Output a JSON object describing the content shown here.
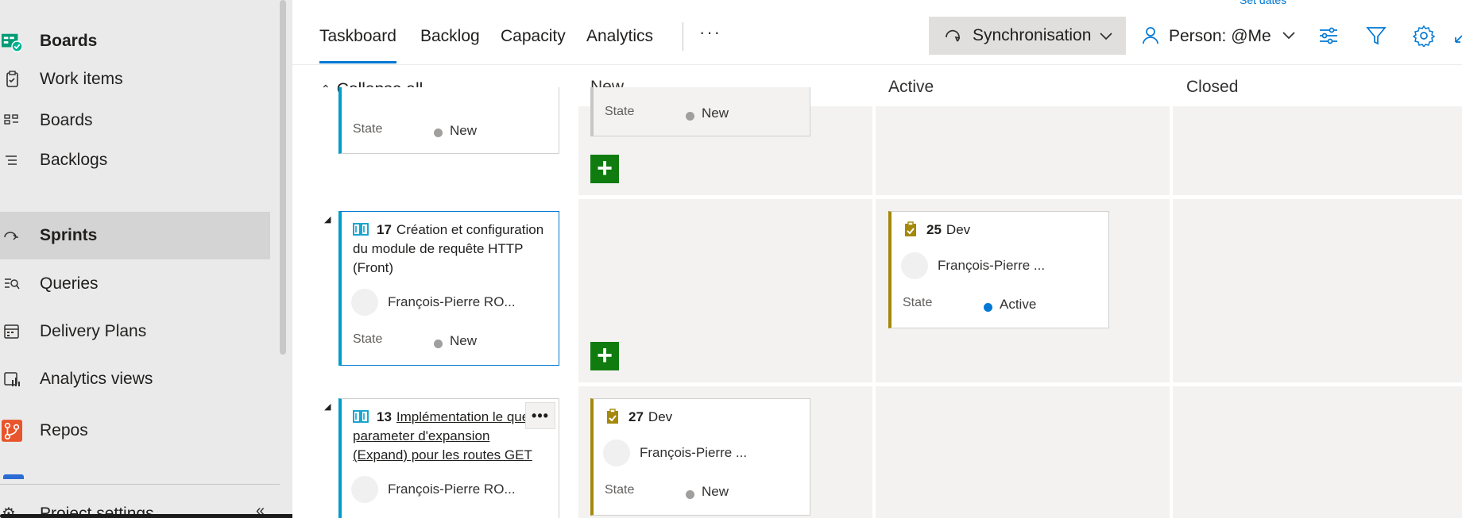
{
  "sidebar": {
    "items": [
      {
        "label": "Boards",
        "icon": "boards-hub-icon"
      },
      {
        "label": "Work items",
        "icon": "work-items-icon"
      },
      {
        "label": "Boards",
        "icon": "boards-icon"
      },
      {
        "label": "Backlogs",
        "icon": "backlogs-icon"
      },
      {
        "label": "Sprints",
        "icon": "sprints-icon"
      },
      {
        "label": "Queries",
        "icon": "queries-icon"
      },
      {
        "label": "Delivery Plans",
        "icon": "delivery-plans-icon"
      },
      {
        "label": "Analytics views",
        "icon": "analytics-views-icon"
      },
      {
        "label": "Repos",
        "icon": "repos-icon"
      }
    ],
    "project_settings": "Project settings"
  },
  "tabs": {
    "items": [
      "Taskboard",
      "Backlog",
      "Capacity",
      "Analytics"
    ],
    "active": "Taskboard",
    "more": "···"
  },
  "toolbar": {
    "set_dates": "Set dates",
    "sync_label": "Synchronisation",
    "person_label": "Person: @Me"
  },
  "board": {
    "collapse_all": "Collapse all",
    "columns": [
      "New",
      "Active",
      "Closed"
    ],
    "state_label": "State",
    "rows": [
      {
        "story": {
          "state": "New"
        },
        "new_cards": [
          {
            "state": "New"
          }
        ]
      },
      {
        "story": {
          "id": "17",
          "title": "Création et configuration du module de requête HTTP (Front)",
          "assignee": "François-Pierre RO...",
          "state": "New"
        },
        "active_cards": [
          {
            "id": "25",
            "title": "Dev",
            "assignee": "François-Pierre ...",
            "state": "Active"
          }
        ]
      },
      {
        "story": {
          "id": "13",
          "title": "Implémentation le query parameter d'expansion (Expand)  pour les routes GET",
          "assignee": "François-Pierre RO..."
        },
        "new_cards": [
          {
            "id": "27",
            "title": "Dev",
            "assignee": "François-Pierre ...",
            "state": "New"
          }
        ]
      }
    ]
  },
  "colors": {
    "accent": "#0078d4",
    "story_bar": "#009ccc",
    "task_bar": "#a4880a",
    "add_button": "#107c10",
    "column_bg": "#f3f2f1"
  }
}
